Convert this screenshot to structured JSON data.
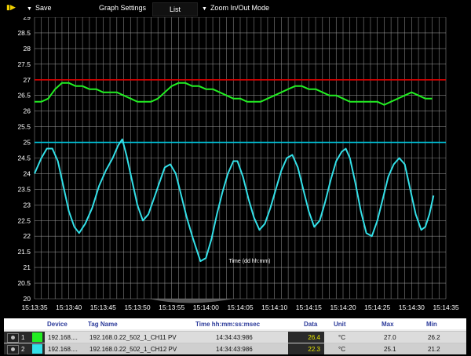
{
  "toolbar": {
    "save_label": "Save",
    "graph_settings_label": "Graph Settings",
    "list_label": "List",
    "zoom_label": "Zoom In/Out Mode"
  },
  "colors": {
    "grid": "#9a9a9a",
    "limit_red": "#e00000",
    "limit_cyan": "#00c8e0",
    "series_green": "#22ee22",
    "series_cyan": "#33e0e8",
    "data_value": "#e8e800"
  },
  "chart_data": {
    "type": "line",
    "xlabel": "Time (dd hh:mm)",
    "ylabel": "",
    "ylim": [
      20,
      29
    ],
    "yticks": [
      "29",
      "28.5",
      "28",
      "27.5",
      "27",
      "26.5",
      "26",
      "25.5",
      "25",
      "24.5",
      "24",
      "23.5",
      "23",
      "22.5",
      "22",
      "21.5",
      "21",
      "20.5",
      "20"
    ],
    "xticks": [
      "15:13:35",
      "15:13:40",
      "15:13:45",
      "15:13:50",
      "15:13:55",
      "15:14:00",
      "15:14:05",
      "15:14:10",
      "15:14:15",
      "15:14:20",
      "15:14:25",
      "15:14:30",
      "15:14:35"
    ],
    "x_range_seconds": [
      0,
      60
    ],
    "grid": true,
    "horizontal_lines": [
      {
        "value": 27,
        "color": "#e00000"
      },
      {
        "value": 25,
        "color": "#00c8e0"
      }
    ],
    "series": [
      {
        "color": "#22ee22",
        "points": [
          [
            0,
            26.3
          ],
          [
            1,
            26.3
          ],
          [
            2,
            26.4
          ],
          [
            3,
            26.7
          ],
          [
            4,
            26.9
          ],
          [
            5,
            26.9
          ],
          [
            6,
            26.8
          ],
          [
            7,
            26.8
          ],
          [
            8,
            26.7
          ],
          [
            9,
            26.7
          ],
          [
            10,
            26.6
          ],
          [
            11,
            26.6
          ],
          [
            12,
            26.6
          ],
          [
            13,
            26.5
          ],
          [
            14,
            26.4
          ],
          [
            15,
            26.3
          ],
          [
            16,
            26.3
          ],
          [
            17,
            26.3
          ],
          [
            18,
            26.4
          ],
          [
            19,
            26.6
          ],
          [
            20,
            26.8
          ],
          [
            21,
            26.9
          ],
          [
            22,
            26.9
          ],
          [
            23,
            26.8
          ],
          [
            24,
            26.8
          ],
          [
            25,
            26.7
          ],
          [
            26,
            26.7
          ],
          [
            27,
            26.6
          ],
          [
            28,
            26.5
          ],
          [
            29,
            26.4
          ],
          [
            30,
            26.4
          ],
          [
            31,
            26.3
          ],
          [
            32,
            26.3
          ],
          [
            33,
            26.3
          ],
          [
            34,
            26.4
          ],
          [
            35,
            26.5
          ],
          [
            36,
            26.6
          ],
          [
            37,
            26.7
          ],
          [
            38,
            26.8
          ],
          [
            39,
            26.8
          ],
          [
            40,
            26.7
          ],
          [
            41,
            26.7
          ],
          [
            42,
            26.6
          ],
          [
            43,
            26.5
          ],
          [
            44,
            26.5
          ],
          [
            45,
            26.4
          ],
          [
            46,
            26.3
          ],
          [
            47,
            26.3
          ],
          [
            48,
            26.3
          ],
          [
            49,
            26.3
          ],
          [
            50,
            26.3
          ],
          [
            51,
            26.2
          ],
          [
            52,
            26.3
          ],
          [
            53,
            26.4
          ],
          [
            54,
            26.5
          ],
          [
            55,
            26.6
          ],
          [
            56,
            26.5
          ],
          [
            57,
            26.4
          ],
          [
            58,
            26.4
          ]
        ]
      },
      {
        "color": "#33e0e8",
        "points": [
          [
            0,
            24.0
          ],
          [
            1,
            24.5
          ],
          [
            1.8,
            24.8
          ],
          [
            2.6,
            24.8
          ],
          [
            3.4,
            24.4
          ],
          [
            4.2,
            23.6
          ],
          [
            5,
            22.8
          ],
          [
            5.8,
            22.3
          ],
          [
            6.5,
            22.1
          ],
          [
            7.4,
            22.4
          ],
          [
            8.4,
            22.9
          ],
          [
            9.4,
            23.6
          ],
          [
            10.4,
            24.1
          ],
          [
            11.4,
            24.5
          ],
          [
            12.2,
            24.9
          ],
          [
            12.8,
            25.1
          ],
          [
            13.4,
            24.6
          ],
          [
            14.2,
            23.8
          ],
          [
            15,
            23.0
          ],
          [
            15.8,
            22.5
          ],
          [
            16.6,
            22.7
          ],
          [
            17.4,
            23.2
          ],
          [
            18.2,
            23.7
          ],
          [
            19,
            24.2
          ],
          [
            19.8,
            24.3
          ],
          [
            20.6,
            24.0
          ],
          [
            21.4,
            23.3
          ],
          [
            22.2,
            22.6
          ],
          [
            23,
            22.0
          ],
          [
            23.6,
            21.6
          ],
          [
            24.2,
            21.2
          ],
          [
            25,
            21.3
          ],
          [
            25.8,
            21.9
          ],
          [
            26.6,
            22.7
          ],
          [
            27.4,
            23.4
          ],
          [
            28.2,
            24.0
          ],
          [
            29,
            24.4
          ],
          [
            29.6,
            24.4
          ],
          [
            30.4,
            23.9
          ],
          [
            31.2,
            23.2
          ],
          [
            32,
            22.6
          ],
          [
            32.8,
            22.2
          ],
          [
            33.6,
            22.4
          ],
          [
            34.4,
            22.9
          ],
          [
            35.2,
            23.5
          ],
          [
            36,
            24.1
          ],
          [
            36.8,
            24.5
          ],
          [
            37.6,
            24.6
          ],
          [
            38.4,
            24.2
          ],
          [
            39.2,
            23.5
          ],
          [
            40,
            22.8
          ],
          [
            40.8,
            22.3
          ],
          [
            41.6,
            22.5
          ],
          [
            42.4,
            23.1
          ],
          [
            43.2,
            23.8
          ],
          [
            44,
            24.4
          ],
          [
            44.8,
            24.7
          ],
          [
            45.4,
            24.8
          ],
          [
            46,
            24.5
          ],
          [
            46.8,
            23.7
          ],
          [
            47.6,
            22.8
          ],
          [
            48.4,
            22.1
          ],
          [
            49.2,
            22.0
          ],
          [
            50,
            22.5
          ],
          [
            50.8,
            23.2
          ],
          [
            51.6,
            23.9
          ],
          [
            52.4,
            24.3
          ],
          [
            53.2,
            24.5
          ],
          [
            54,
            24.3
          ],
          [
            54.8,
            23.5
          ],
          [
            55.6,
            22.7
          ],
          [
            56.4,
            22.2
          ],
          [
            57,
            22.3
          ],
          [
            57.6,
            22.7
          ],
          [
            58.2,
            23.3
          ]
        ]
      }
    ]
  },
  "table": {
    "headers": {
      "device": "Device",
      "tag": "Tag Name",
      "time": "Time hh:mm:ss:msec",
      "data": "Data",
      "unit": "Unit",
      "max": "Max",
      "min": "Min"
    },
    "rows": [
      {
        "num": "1",
        "color": "#22ee22",
        "device": "192.168....",
        "tag": "192.168.0.22_502_1_CH11 PV",
        "time": "14:34:43:986",
        "data": "26.4",
        "unit": "°C",
        "max": "27.0",
        "min": "26.2"
      },
      {
        "num": "2",
        "color": "#33e0e8",
        "device": "192.168....",
        "tag": "192.168.0.22_502_1_CH12 PV",
        "time": "14:34:43:986",
        "data": "22.3",
        "unit": "°C",
        "max": "25.1",
        "min": "21.2"
      }
    ]
  }
}
